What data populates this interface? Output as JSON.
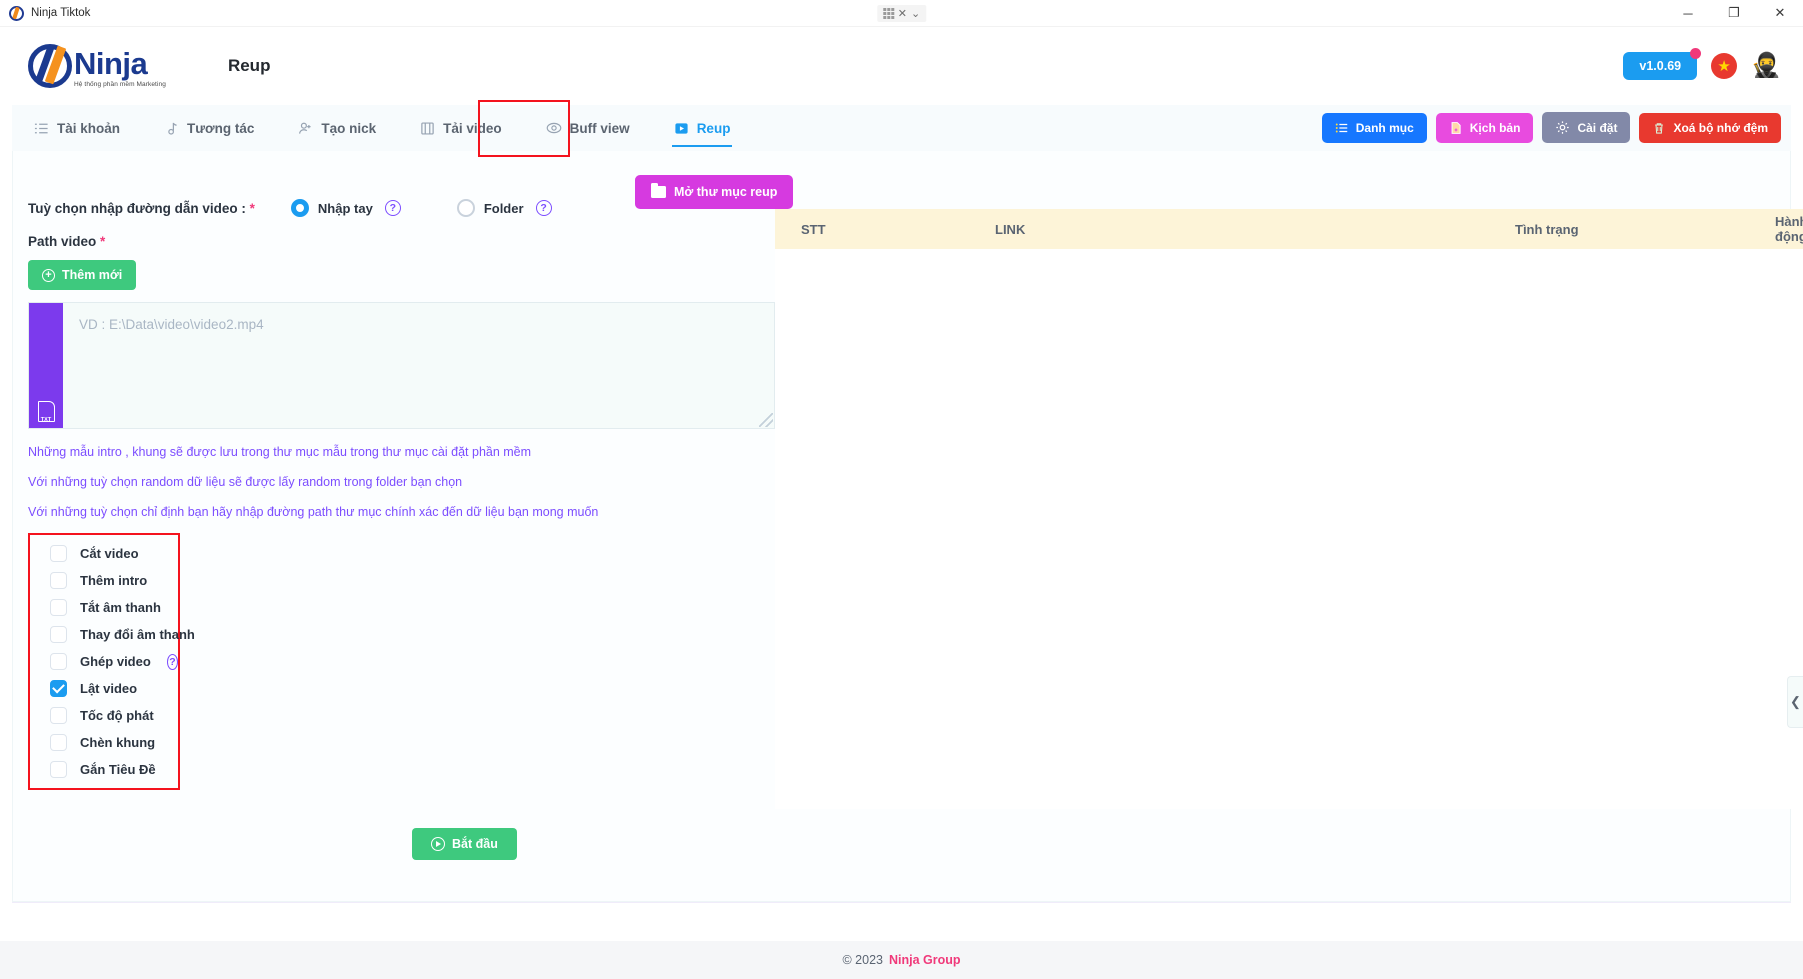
{
  "window": {
    "app_icon": "ninja-circle-icon",
    "title": "Ninja Tiktok",
    "center_widget": {
      "grid_icon": "grid-icon",
      "close_icon": "collapse-x-icon",
      "chevron_icon": "chevron-down-icon"
    },
    "minimize": "─",
    "maximize": "❐",
    "close": "✕"
  },
  "header": {
    "logo_text": "Ninja",
    "logo_tagline": "Hệ thống phần mềm Marketing",
    "page_title": "Reup",
    "version": "v1.0.69",
    "flag_star": "★",
    "avatar": "🥷",
    "accent_blue": "#1b9cf0",
    "accent_pink": "#f0397a"
  },
  "tabs": [
    {
      "label": "Tài khoản",
      "icon": "list-checklist-icon",
      "active": false
    },
    {
      "label": "Tương tác",
      "icon": "music-note-icon",
      "active": false
    },
    {
      "label": "Tạo nick",
      "icon": "person-add-icon",
      "active": false
    },
    {
      "label": "Tải video",
      "icon": "film-strip-icon",
      "active": false
    },
    {
      "label": "Buff view",
      "icon": "eye-icon",
      "active": false
    },
    {
      "label": "Reup",
      "icon": "play-square-icon",
      "active": true
    }
  ],
  "header_actions": [
    {
      "label": "Danh mục",
      "icon": "list-bullets-icon",
      "color": "#1677ff"
    },
    {
      "label": "Kịch bản",
      "icon": "file-plus-icon",
      "color": "#e84bdf"
    },
    {
      "label": "Cài đặt",
      "icon": "gear-icon",
      "color": "#8289a8"
    },
    {
      "label": "Xoá bộ nhớ đệm",
      "icon": "trash-icon",
      "color": "#e8392f"
    }
  ],
  "form": {
    "path_option_label": "Tuỳ chọn nhập đường dẫn video :",
    "required_mark": "*",
    "radios": [
      {
        "label": "Nhập tay",
        "selected": true,
        "help_icon": "help-circle-icon"
      },
      {
        "label": "Folder",
        "selected": false,
        "help_icon": "help-circle-icon"
      }
    ],
    "path_video_label": "Path video",
    "add_new_button": "Thêm mới",
    "add_new_icon": "plus-circle-icon",
    "textarea": {
      "value": "",
      "placeholder": "VD : E:\\Data\\video\\video2.mp4",
      "side_icon": "txt-file-icon",
      "side_icon_label": "TXT"
    },
    "hints": [
      "Những mẫu intro , khung sẽ được lưu trong thư mục mẫu trong thư mục cài đặt phần mềm",
      "Với những tuỳ chọn random dữ liệu sẽ được lấy random trong folder bạn chọn",
      "Với những tuỳ chọn chỉ định bạn hãy nhập đường path thư mục chính xác đến dữ liệu bạn mong muốn"
    ],
    "options": [
      {
        "label": "Cắt video",
        "checked": false,
        "help": false
      },
      {
        "label": "Thêm intro",
        "checked": false,
        "help": false
      },
      {
        "label": "Tắt âm thanh",
        "checked": false,
        "help": false
      },
      {
        "label": "Thay đổi âm thanh",
        "checked": false,
        "help": false
      },
      {
        "label": "Ghép video",
        "checked": false,
        "help": true
      },
      {
        "label": "Lật video",
        "checked": true,
        "help": false
      },
      {
        "label": "Tốc độ phát",
        "checked": false,
        "help": false
      },
      {
        "label": "Chèn khung",
        "checked": false,
        "help": false
      },
      {
        "label": "Gắn Tiêu Đề",
        "checked": false,
        "help": false
      }
    ],
    "start_button": "Bắt đầu",
    "start_icon": "play-circle-icon"
  },
  "right_panel": {
    "open_folder_button": "Mở thư mục reup",
    "open_folder_icon": "folder-icon",
    "table": {
      "columns": [
        "STT",
        "LINK",
        "Tình trạng",
        "Hành động"
      ],
      "rows": []
    },
    "collapse_handle_icon": "chevron-left-icon"
  },
  "footer": {
    "copyright": "© 2023",
    "brand": "Ninja Group"
  }
}
